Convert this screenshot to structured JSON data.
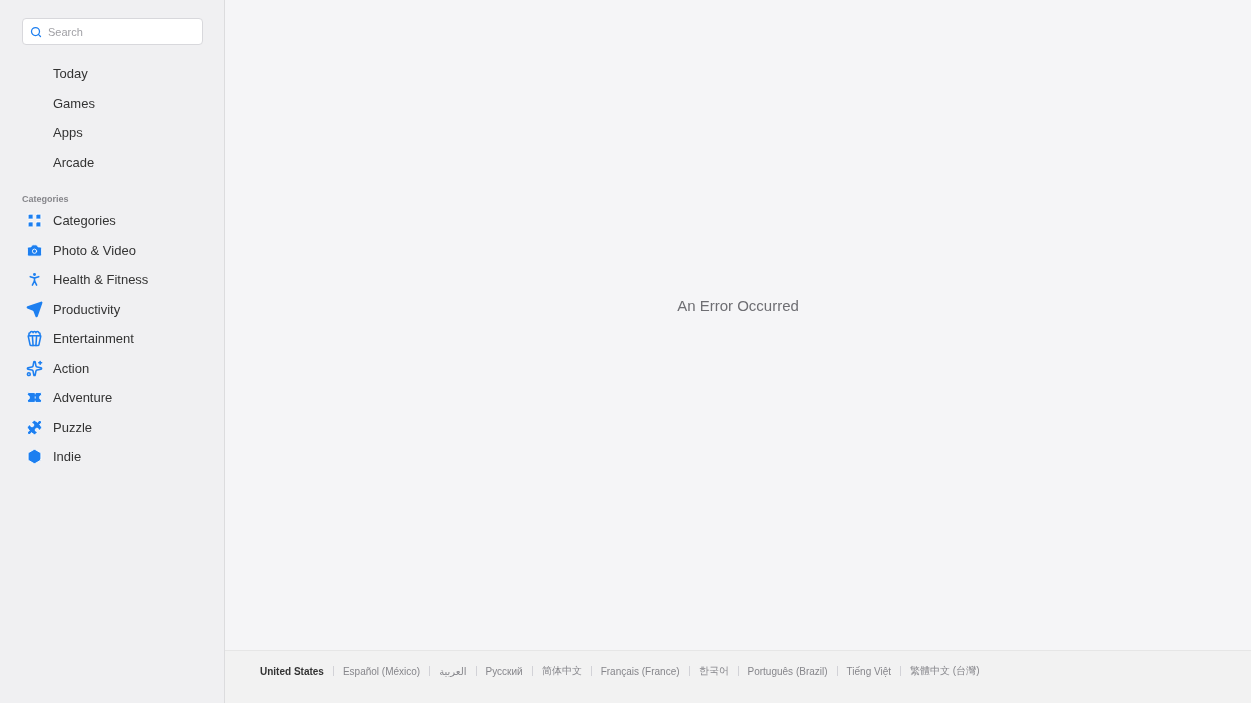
{
  "sidebar": {
    "search": {
      "placeholder": "Search"
    },
    "nav_items": [
      {
        "label": "Today"
      },
      {
        "label": "Games"
      },
      {
        "label": "Apps"
      },
      {
        "label": "Arcade"
      }
    ],
    "categories_heading": "Categories",
    "categories": [
      {
        "label": "Categories"
      },
      {
        "label": "Photo & Video"
      },
      {
        "label": "Health & Fitness"
      },
      {
        "label": "Productivity"
      },
      {
        "label": "Entertainment"
      },
      {
        "label": "Action"
      },
      {
        "label": "Adventure"
      },
      {
        "label": "Puzzle"
      },
      {
        "label": "Indie"
      }
    ]
  },
  "main": {
    "message": "An Error Occurred"
  },
  "footer": {
    "languages": [
      {
        "label": "United States",
        "selected": true
      },
      {
        "label": "Español (México)",
        "selected": false
      },
      {
        "label": "العربية",
        "selected": false
      },
      {
        "label": "Русский",
        "selected": false
      },
      {
        "label": "简体中文",
        "selected": false
      },
      {
        "label": "Français (France)",
        "selected": false
      },
      {
        "label": "한국어",
        "selected": false
      },
      {
        "label": "Português (Brazil)",
        "selected": false
      },
      {
        "label": "Tiếng Việt",
        "selected": false
      },
      {
        "label": "繁體中文 (台灣)",
        "selected": false
      }
    ]
  }
}
